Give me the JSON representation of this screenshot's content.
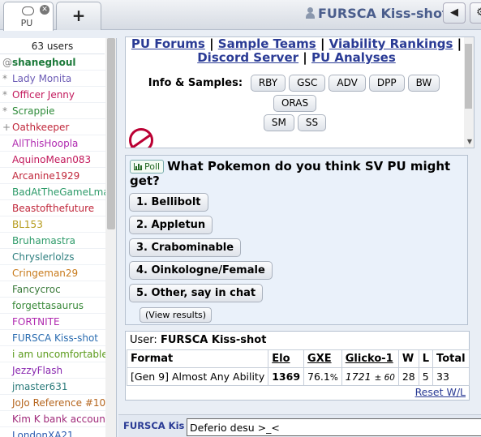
{
  "header": {
    "tab_label": "PU",
    "tab_close": "✕",
    "new_tab": "+",
    "username": "FURSCA Kiss-shot",
    "sound_icon": "◀",
    "gear_icon": "⚙"
  },
  "userlist": {
    "count": "63 users",
    "users": [
      {
        "rank": "@",
        "name": "shaneghoul",
        "color": "#1c7a3a",
        "bold": true
      },
      {
        "rank": "*",
        "name": "Lady Monita",
        "color": "#6b5bb5"
      },
      {
        "rank": "*",
        "name": "Officer Jenny",
        "color": "#c2185b"
      },
      {
        "rank": "*",
        "name": "Scrappie",
        "color": "#2e8b3a"
      },
      {
        "rank": "+",
        "name": "Oathkeeper",
        "color": "#c0263a"
      },
      {
        "rank": "",
        "name": "AllThisHoopla",
        "color": "#b02ab0"
      },
      {
        "rank": "",
        "name": "AquinoMean083",
        "color": "#c2185b"
      },
      {
        "rank": "",
        "name": "Arcanine1929",
        "color": "#c0263a"
      },
      {
        "rank": "",
        "name": "BadAtTheGameLmao",
        "color": "#2e9b6a"
      },
      {
        "rank": "",
        "name": "Beastofthefuture",
        "color": "#c0263a"
      },
      {
        "rank": "",
        "name": "BL153",
        "color": "#b59a1a"
      },
      {
        "rank": "",
        "name": "Bruhamastra",
        "color": "#2e9b6a"
      },
      {
        "rank": "",
        "name": "Chryslerlolzs",
        "color": "#2e7f7f"
      },
      {
        "rank": "",
        "name": "Cringeman29",
        "color": "#c87a1a"
      },
      {
        "rank": "",
        "name": "Fancycroc",
        "color": "#3a7a3a"
      },
      {
        "rank": "",
        "name": "forgettasaurus",
        "color": "#3a8a3a"
      },
      {
        "rank": "",
        "name": "FORTNITE",
        "color": "#b02ab0"
      },
      {
        "rank": "",
        "name": "FURSCA Kiss-shot",
        "color": "#2a6cb0"
      },
      {
        "rank": "",
        "name": "i am uncomfortable",
        "color": "#5a9a1a"
      },
      {
        "rank": "",
        "name": "JezzyFlash",
        "color": "#8a2ab0"
      },
      {
        "rank": "",
        "name": "jmaster631",
        "color": "#2a7a7a"
      },
      {
        "rank": "",
        "name": "JoJo Reference #10",
        "color": "#b5651d"
      },
      {
        "rank": "",
        "name": "Kim K bank account",
        "color": "#a02a7a"
      },
      {
        "rank": "",
        "name": "LondonXA21",
        "color": "#2a5ab0"
      }
    ]
  },
  "intro": {
    "links": [
      "PU Forums",
      "Sample Teams",
      "Viability Rankings",
      "Discord Server",
      "PU Analyses"
    ],
    "sep": "|",
    "samples_label": "Info & Samples:",
    "samples": [
      "RBY",
      "GSC",
      "ADV",
      "DPP",
      "BW",
      "ORAS",
      "SM",
      "SS"
    ]
  },
  "poll": {
    "badge": "Poll",
    "question": "What Pokemon do you think SV PU might get?",
    "options": [
      "1. Bellibolt",
      "2. Appletun",
      "3. Crabominable",
      "4. Oinkologne/Female",
      "5. Other, say in chat"
    ],
    "view_results": "(View results)"
  },
  "ladder": {
    "user_label": "User:",
    "user": "FURSCA Kiss-shot",
    "headers": [
      "Format",
      "Elo",
      "GXE",
      "Glicko-1",
      "W",
      "L",
      "Total"
    ],
    "row": {
      "format": "[Gen 9] Almost Any Ability",
      "elo": "1369",
      "gxe": "76.1",
      "gxe_unit": "%",
      "glicko": "1721",
      "glicko_pm": "± 60",
      "w": "28",
      "l": "5",
      "total": "33"
    },
    "reset": "Reset W/L"
  },
  "chat": {
    "name": "FURSCA Kiss-shot",
    "input_value": "Deferio desu >_<"
  }
}
